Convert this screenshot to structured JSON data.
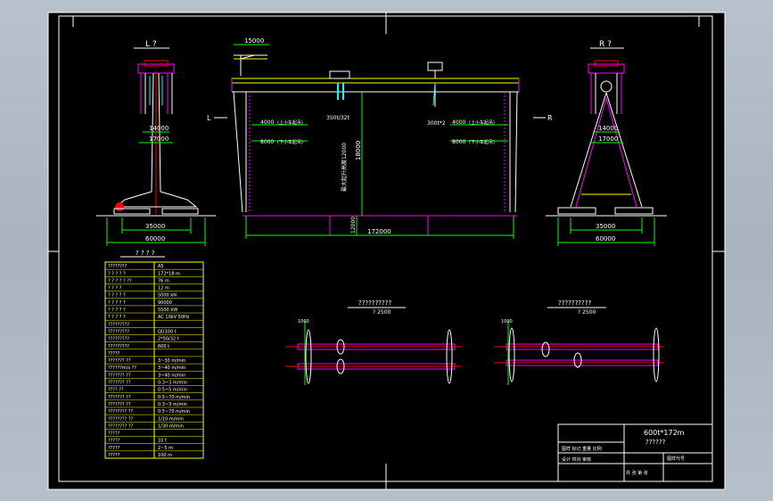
{
  "views": {
    "left_label": "L ?",
    "right_label": "R ?",
    "arrow_left": "L",
    "arrow_right": "R"
  },
  "dims": {
    "trolley": "15000",
    "track": "35000",
    "base": "60000",
    "leg_top_a": "14000",
    "leg_top_b": "17000",
    "span": "172000",
    "height": "18000",
    "lower": "12000",
    "d4000": "4000",
    "d8000": "8000",
    "hook_left": "350t/32t",
    "hook_right": "300t*2",
    "note_up": "(上小车起吊)",
    "note_down": "(下小车起吊)",
    "vertical_note": "最大起升高度12000"
  },
  "spec_title": "? ? ? ?",
  "spec_rows": [
    {
      "k": "????????",
      "v": "A5"
    },
    {
      "k": "? ? ? ? ?",
      "v": "172*18 m"
    },
    {
      "k": "? ? ? ? ?  ??",
      "v": "76  m"
    },
    {
      "k": "? ? ? ?",
      "v": "12  m"
    },
    {
      "k": "? ? ? ? ?",
      "v": "5000 kN"
    },
    {
      "k": "? ? ? ? ?",
      "v": "90000"
    },
    {
      "k": "? ? ? ? ?",
      "v": "5500 kW"
    },
    {
      "k": "? ? ? ? ?",
      "v": "AC 10kV 50Hz"
    },
    {
      "k": "?????????",
      "v": ""
    },
    {
      "k": "?????????",
      "v": "QU100  t"
    },
    {
      "k": "?????????",
      "v": "2*50/32  t"
    },
    {
      "k": "?????????",
      "v": "600  t"
    },
    {
      "k": "?????",
      "v": ""
    },
    {
      "k": "???????  ??",
      "v": "3~30  m/min"
    },
    {
      "k": "??????m/s  ??",
      "v": "3~40  m/min"
    },
    {
      "k": "???????  ??",
      "v": "3~40  m/min"
    },
    {
      "k": "???????  ??",
      "v": "0.3~3  m/min"
    },
    {
      "k": "????  ??",
      "v": "0.5~5  m/min"
    },
    {
      "k": "???????  ??",
      "v": "0.5~70  m/min"
    },
    {
      "k": "???????  ??",
      "v": "0.3~3  m/min"
    },
    {
      "k": "????????  ??",
      "v": "0.5~70  m/min"
    },
    {
      "k": "????????  ??",
      "v": "1/10  m/min"
    },
    {
      "k": "????????  ??",
      "v": "1/30  m/min"
    },
    {
      "k": "?????",
      "v": ""
    },
    {
      "k": "?????",
      "v": "10  t"
    },
    {
      "k": "?????",
      "v": "2~5  m"
    },
    {
      "k": "?????",
      "v": "100  m"
    }
  ],
  "detail_a": {
    "title": "??????????",
    "scale": "? 2500",
    "tag": "1000"
  },
  "detail_b": {
    "title": "??????????",
    "scale": "? 2500",
    "tag": "1000"
  },
  "title_block": {
    "name": "600t*172m",
    "subtitle": "??????",
    "row1": "图样 标记 重量 比例",
    "row2": "设计 校对 审核",
    "sheet": "共 张 第 张",
    "drawing_no": "图样代号"
  },
  "colors": {
    "paper": "#000000",
    "yellow": "#ffff00",
    "magenta": "#ff00ff",
    "cyan": "#00ffff",
    "green": "#00ff00",
    "red": "#ff0000",
    "white": "#ffffff"
  }
}
